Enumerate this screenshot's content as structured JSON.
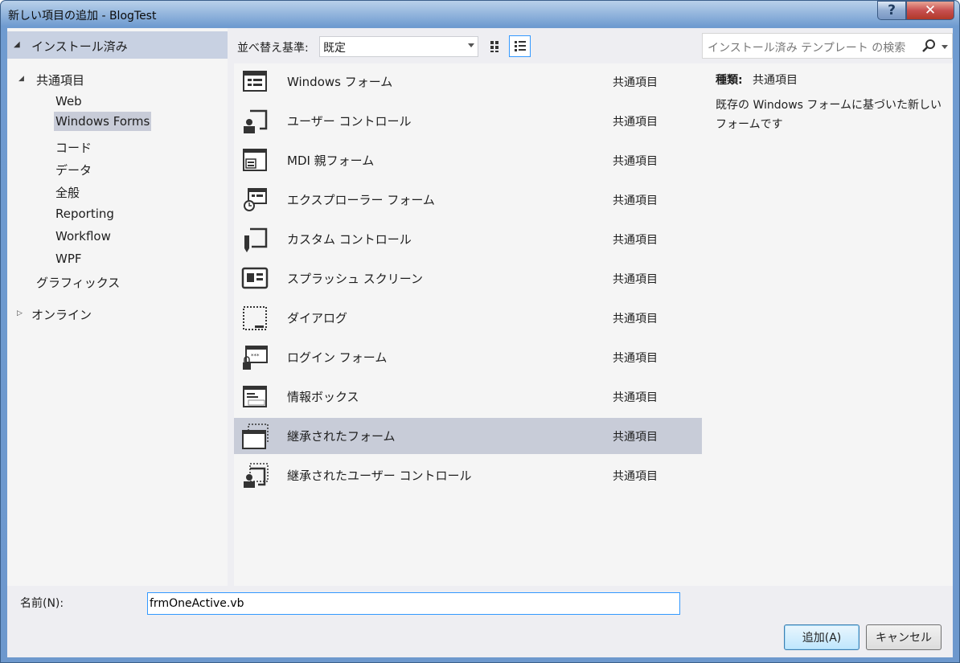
{
  "window": {
    "title": "新しい項目の追加 - BlogTest",
    "help_label": "?",
    "close_label": "✕"
  },
  "tree": {
    "header": "インストール済み",
    "nodes": [
      {
        "label": "共通項目",
        "expanded": true
      },
      {
        "label": "Web"
      },
      {
        "label": "Windows Forms",
        "selected": true
      },
      {
        "label": "コード"
      },
      {
        "label": "データ"
      },
      {
        "label": "全般"
      },
      {
        "label": "Reporting"
      },
      {
        "label": "Workflow"
      },
      {
        "label": "WPF"
      },
      {
        "label": "グラフィックス"
      },
      {
        "label": "オンライン",
        "collapsed": true
      }
    ]
  },
  "toolbar": {
    "sort_label": "並べ替え基準:",
    "sort_value": "既定"
  },
  "templates": [
    {
      "name": "Windows フォーム",
      "category": "共通項目",
      "icon": "windows-form-icon"
    },
    {
      "name": "ユーザー コントロール",
      "category": "共通項目",
      "icon": "user-control-icon"
    },
    {
      "name": "MDI 親フォーム",
      "category": "共通項目",
      "icon": "mdi-form-icon"
    },
    {
      "name": "エクスプローラー フォーム",
      "category": "共通項目",
      "icon": "explorer-form-icon"
    },
    {
      "name": "カスタム コントロール",
      "category": "共通項目",
      "icon": "custom-control-icon"
    },
    {
      "name": "スプラッシュ スクリーン",
      "category": "共通項目",
      "icon": "splash-screen-icon"
    },
    {
      "name": "ダイアログ",
      "category": "共通項目",
      "icon": "dialog-icon"
    },
    {
      "name": "ログイン フォーム",
      "category": "共通項目",
      "icon": "login-form-icon"
    },
    {
      "name": "情報ボックス",
      "category": "共通項目",
      "icon": "about-box-icon"
    },
    {
      "name": "継承されたフォーム",
      "category": "共通項目",
      "icon": "inherited-form-icon",
      "selected": true
    },
    {
      "name": "継承されたユーザー コントロール",
      "category": "共通項目",
      "icon": "inherited-user-control-icon"
    }
  ],
  "search": {
    "placeholder": "インストール済み テンプレート の検索"
  },
  "details": {
    "type_label": "種類:",
    "type_value": "共通項目",
    "description": "既存の Windows フォームに基づいた新しいフォームです"
  },
  "bottom": {
    "name_label": "名前(N):",
    "name_value": "frmOneActive.vb",
    "add_label": "追加(A)",
    "cancel_label": "キャンセル"
  },
  "colors": {
    "selection": "#c8ccd8",
    "accent": "#3399ff",
    "panel": "#f5f5f5"
  }
}
